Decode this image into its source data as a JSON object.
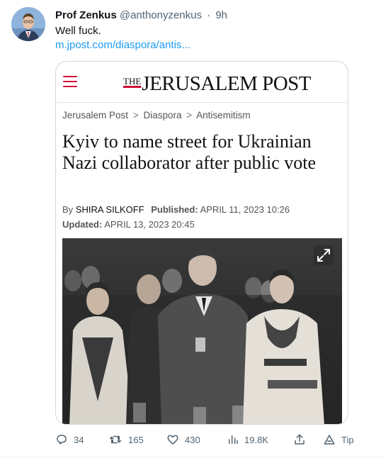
{
  "author": {
    "display_name": "Prof Zenkus",
    "handle": "@anthonyzenkus",
    "separator": "·",
    "time": "9h"
  },
  "tweet": {
    "text": "Well fuck.",
    "link": "m.jpost.com/diaspora/antis..."
  },
  "card": {
    "logo_the": "THE",
    "logo_name": "JERUSALEM POST",
    "breadcrumb": [
      "Jerusalem Post",
      "Diaspora",
      "Antisemitism"
    ],
    "breadcrumb_sep": ">",
    "headline": "Kyiv to name street for Ukrainian Nazi collaborator after public vote",
    "by_prefix": "By",
    "author": "SHIRA SILKOFF",
    "published_label": "Published:",
    "published": "APRIL 11, 2023 10:26",
    "updated_label": "Updated:",
    "updated": "APRIL 13, 2023 20:45"
  },
  "actions": {
    "replies": "34",
    "retweets": "165",
    "likes": "430",
    "views": "19.8K",
    "tip": "Tip"
  },
  "colors": {
    "link": "#1d9bf0",
    "muted": "#536471",
    "brand_red": "#d0103a",
    "border": "#cfd9de"
  }
}
